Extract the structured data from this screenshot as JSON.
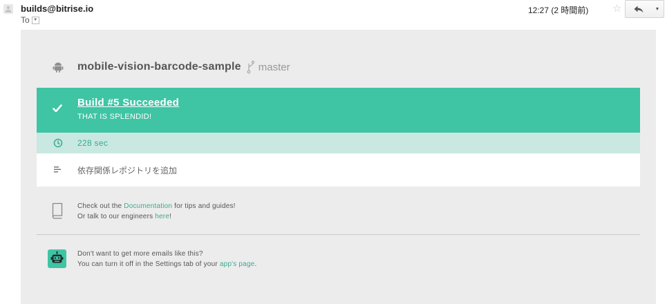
{
  "header": {
    "sender": "builds@bitrise.io",
    "to_label": "To",
    "timestamp": "12:27 (2 時間前)"
  },
  "email": {
    "repo_name": "mobile-vision-barcode-sample",
    "branch": "master",
    "build_title": "Build #5 Succeeded",
    "build_subtitle": "THAT IS SPLENDID!",
    "duration": "228 sec",
    "commit_message": "依存関係レポジトリを追加",
    "docs": {
      "prefix": "Check out the ",
      "link": "Documentation",
      "suffix": " for tips and guides!",
      "line2_prefix": "Or talk to our engineers ",
      "line2_link": "here",
      "line2_suffix": "!"
    },
    "unsubscribe": {
      "line1": "Don't want to get more emails like this?",
      "line2_prefix": "You can turn it off in the Settings tab of your ",
      "line2_link": "app's page",
      "line2_suffix": "."
    }
  },
  "colors": {
    "success": "#3fc4a4",
    "duration_bg": "#c8e8e1",
    "link": "#3aab8e",
    "body_bg": "#ececec"
  }
}
